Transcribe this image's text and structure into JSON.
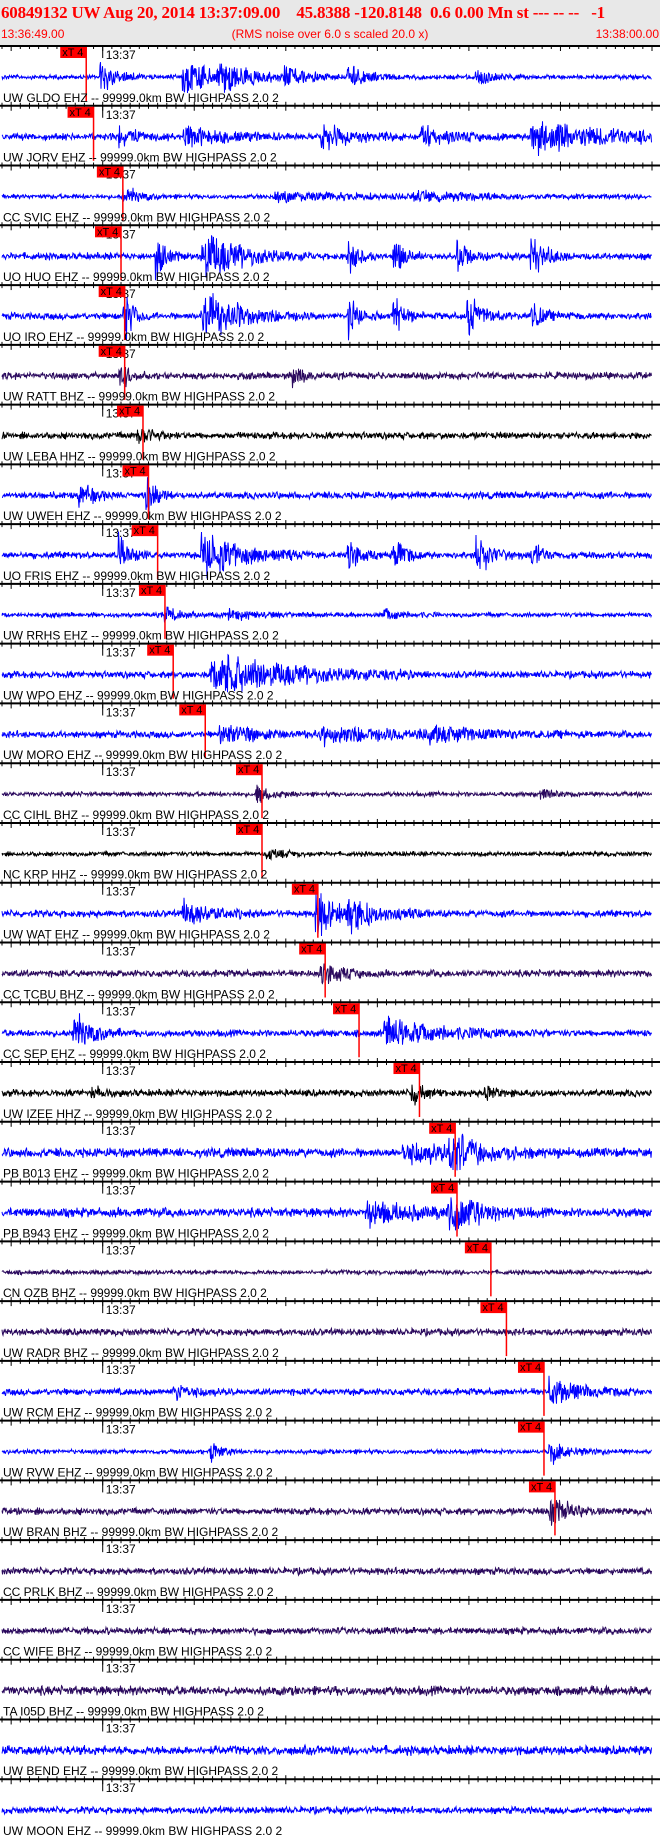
{
  "header": {
    "title": "60849132 UW Aug 20, 2014 13:37:09.00    45.8388 -120.8148  0.6 0.00 Mn st --- -- --   -1",
    "start_time": "13:36:49.00",
    "note": "(RMS noise over 6.0 s scaled 20.0 x)",
    "end_time": "13:38:00.00"
  },
  "axis": {
    "minute_label": "13:37",
    "minute_offset_s": 11,
    "window_s": 71
  },
  "pick_label": "xT 4",
  "colors": {
    "EHZ": "#0000ff",
    "BHZ": "#2b0a5e",
    "HHZ": "#000000",
    "pick": "#ff0000",
    "header_text": "#ff0000"
  },
  "label_suffix": " -- 99999.0km BW  HIGHPASS  2.0  2",
  "traces": [
    {
      "station": "UW GLDO EHZ",
      "pick_s": 9.2,
      "noise": 2,
      "bursts": [
        [
          11,
          18,
          1.5
        ],
        [
          20,
          20,
          4
        ],
        [
          24,
          16,
          3
        ],
        [
          31,
          10,
          3
        ],
        [
          38,
          12,
          2
        ],
        [
          52,
          8,
          2
        ]
      ]
    },
    {
      "station": "UW JORV EHZ",
      "pick_s": 10.0,
      "noise": 3,
      "bursts": [
        [
          13,
          10,
          2
        ],
        [
          20,
          12,
          4
        ],
        [
          35,
          16,
          3
        ],
        [
          46,
          12,
          3
        ],
        [
          58,
          20,
          8
        ]
      ]
    },
    {
      "station": "CC SVIC EHZ",
      "pick_s": 13.2,
      "noise": 2,
      "bursts": [
        [
          13.5,
          12,
          1.5
        ],
        [
          30,
          6,
          8
        ],
        [
          45,
          5,
          8
        ]
      ]
    },
    {
      "station": "UO HUO EHZ",
      "pick_s": 13.0,
      "noise": 3,
      "bursts": [
        [
          17,
          26,
          1
        ],
        [
          22,
          30,
          4
        ],
        [
          38,
          20,
          1
        ],
        [
          43,
          20,
          1
        ],
        [
          50,
          18,
          1
        ],
        [
          58,
          22,
          1.5
        ]
      ]
    },
    {
      "station": "UO IRO EHZ",
      "pick_s": 13.4,
      "noise": 3,
      "bursts": [
        [
          13.5,
          26,
          1
        ],
        [
          22,
          30,
          4
        ],
        [
          38,
          22,
          1
        ],
        [
          43,
          20,
          1
        ],
        [
          51,
          24,
          1.5
        ],
        [
          58,
          18,
          1
        ]
      ]
    },
    {
      "station": "UW RATT BHZ",
      "pick_s": 13.4,
      "noise": 3,
      "bursts": [
        [
          13,
          14,
          1
        ],
        [
          32,
          10,
          1
        ]
      ]
    },
    {
      "station": "UW LEBA HHZ",
      "pick_s": 15.4,
      "noise": 3,
      "bursts": [
        [
          15,
          10,
          1.5
        ]
      ]
    },
    {
      "station": "UW UWEH EHZ",
      "pick_s": 16.0,
      "noise": 3,
      "bursts": [
        [
          8.5,
          14,
          1.5
        ],
        [
          16,
          18,
          1
        ]
      ]
    },
    {
      "station": "UO FRIS EHZ",
      "pick_s": 17.0,
      "noise": 3,
      "bursts": [
        [
          13,
          22,
          1
        ],
        [
          22,
          28,
          4
        ],
        [
          38,
          20,
          1
        ],
        [
          43,
          22,
          1
        ],
        [
          52,
          24,
          1.5
        ],
        [
          58,
          16,
          1
        ]
      ]
    },
    {
      "station": "UW RRHS EHZ",
      "pick_s": 17.8,
      "noise": 2,
      "bursts": [
        [
          18,
          8,
          2
        ],
        [
          25,
          6,
          3
        ],
        [
          42,
          6,
          2
        ]
      ]
    },
    {
      "station": "UW WPO EHZ",
      "pick_s": 18.7,
      "noise": 3,
      "bursts": [
        [
          23,
          28,
          8
        ]
      ]
    },
    {
      "station": "UW MORO EHZ",
      "pick_s": 22.2,
      "noise": 3,
      "bursts": [
        [
          24,
          12,
          4
        ],
        [
          35,
          10,
          10
        ],
        [
          47,
          8,
          4
        ]
      ]
    },
    {
      "station": "CC CIHL BHZ",
      "pick_s": 28.4,
      "noise": 2,
      "bursts": [
        [
          28,
          10,
          1.5
        ],
        [
          59,
          6,
          1
        ]
      ]
    },
    {
      "station": "NC KRP HHZ",
      "pick_s": 28.4,
      "noise": 2,
      "bursts": [
        [
          29,
          6,
          2
        ]
      ]
    },
    {
      "station": "UW WAT EHZ",
      "pick_s": 34.5,
      "noise": 3,
      "bursts": [
        [
          20,
          14,
          3
        ],
        [
          34.5,
          26,
          2
        ],
        [
          38,
          20,
          3
        ]
      ]
    },
    {
      "station": "CC TCBU BHZ",
      "pick_s": 35.3,
      "noise": 3,
      "bursts": [
        [
          35,
          14,
          2
        ]
      ]
    },
    {
      "station": "CC SEP EHZ",
      "pick_s": 39.0,
      "noise": 3,
      "bursts": [
        [
          8,
          22,
          2
        ],
        [
          42,
          16,
          6
        ]
      ]
    },
    {
      "station": "UW IZEE HHZ",
      "pick_s": 45.6,
      "noise": 3,
      "bursts": [
        [
          45,
          12,
          1
        ],
        [
          53,
          8,
          1
        ],
        [
          10,
          6,
          1
        ]
      ]
    },
    {
      "station": "PB B013 EHZ",
      "pick_s": 49.5,
      "noise": 4,
      "bursts": [
        [
          49,
          20,
          3
        ],
        [
          44,
          12,
          6
        ]
      ]
    },
    {
      "station": "PB B943 EHZ",
      "pick_s": 49.7,
      "noise": 4,
      "bursts": [
        [
          40,
          16,
          4
        ],
        [
          49,
          26,
          3
        ]
      ]
    },
    {
      "station": "CN OZB BHZ",
      "pick_s": 53.4,
      "noise": 2,
      "bursts": []
    },
    {
      "station": "UW RADR BHZ",
      "pick_s": 55.1,
      "noise": 3,
      "bursts": []
    },
    {
      "station": "UW RCM EHZ",
      "pick_s": 59.2,
      "noise": 3,
      "bursts": [
        [
          19,
          10,
          2
        ],
        [
          60,
          16,
          3
        ]
      ]
    },
    {
      "station": "UW RVW EHZ",
      "pick_s": 59.2,
      "noise": 2,
      "bursts": [
        [
          23,
          12,
          1
        ],
        [
          60,
          14,
          2
        ]
      ]
    },
    {
      "station": "UW BRAN BHZ",
      "pick_s": 60.4,
      "noise": 3,
      "bursts": [
        [
          60,
          18,
          2
        ]
      ]
    },
    {
      "station": "CC PRLK BHZ",
      "pick_s": null,
      "noise": 3,
      "bursts": []
    },
    {
      "station": "CC WIFE BHZ",
      "pick_s": null,
      "noise": 3,
      "bursts": []
    },
    {
      "station": "TA I05D BHZ",
      "pick_s": null,
      "noise": 4,
      "bursts": []
    },
    {
      "station": "UW BEND EHZ",
      "pick_s": null,
      "noise": 4,
      "bursts": []
    },
    {
      "station": "UW MOON EHZ",
      "pick_s": null,
      "noise": 3,
      "bursts": []
    }
  ]
}
